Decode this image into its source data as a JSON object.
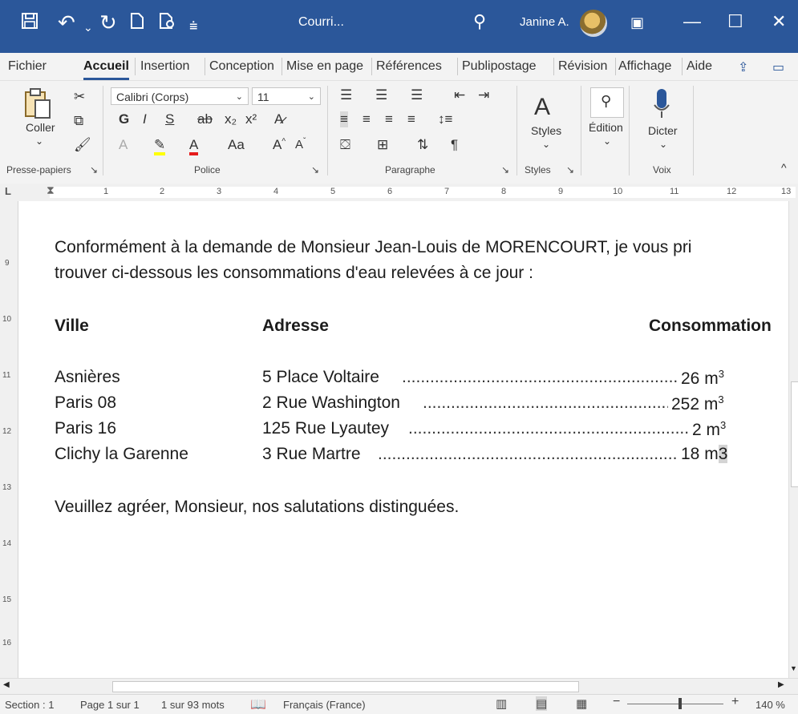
{
  "title_bar": {
    "doc_title": "Courri...",
    "user_name": "Janine A.",
    "accent_color": "#2b579a"
  },
  "tabs": [
    "Fichier",
    "Accueil",
    "Insertion",
    "Conception",
    "Mise en page",
    "Références",
    "Publipostage",
    "Révision",
    "Affichage",
    "Aide"
  ],
  "ribbon": {
    "clipboard": {
      "paste_label": "Coller",
      "group_label": "Presse-papiers"
    },
    "font": {
      "font_name": "Calibri (Corps)",
      "font_size": "11",
      "bold": "G",
      "italic": "I",
      "underline": "S",
      "case": "Aa",
      "grow": "A",
      "group_label": "Police"
    },
    "paragraph": {
      "pilcrow": "¶",
      "group_label": "Paragraphe"
    },
    "styles": {
      "styles_label": "Styles",
      "group_label": "Styles"
    },
    "editing": {
      "label": "Édition"
    },
    "voice": {
      "dictate_label": "Dicter",
      "group_label": "Voix"
    }
  },
  "ruler_numbers": [
    "1",
    "2",
    "3",
    "4",
    "5",
    "6",
    "7",
    "8",
    "9",
    "10",
    "11",
    "12",
    "13"
  ],
  "vruler_numbers": [
    "9",
    "10",
    "11",
    "12",
    "13",
    "14",
    "15",
    "16"
  ],
  "document": {
    "intro_line1": "Conformément à la demande de Monsieur Jean-Louis de MORENCOURT, je vous pri",
    "intro_line2": "trouver ci-dessous les consommations d'eau relevées à ce jour :",
    "headers": {
      "city": "Ville",
      "address": "Adresse",
      "consumption": "Consommation"
    },
    "rows": [
      {
        "city": "Asnières",
        "address": "5 Place Voltaire",
        "value": "26",
        "unit": "m"
      },
      {
        "city": "Paris 08",
        "address": "2 Rue Washington",
        "value": "252",
        "unit": "m"
      },
      {
        "city": "Paris 16",
        "address": "125 Rue Lyautey",
        "value": "2",
        "unit": "m"
      },
      {
        "city": "Clichy la Garenne",
        "address": "3 Rue Martre",
        "value": "18",
        "unit": "m"
      }
    ],
    "superscript": "3",
    "last_row_unit_suffix": "3",
    "closing": "Veuillez agréer, Monsieur, nos salutations distinguées."
  },
  "status_bar": {
    "section": "Section : 1",
    "page": "Page 1 sur 1",
    "words": "1 sur 93 mots",
    "language": "Français (France)",
    "zoom": "140 %"
  }
}
